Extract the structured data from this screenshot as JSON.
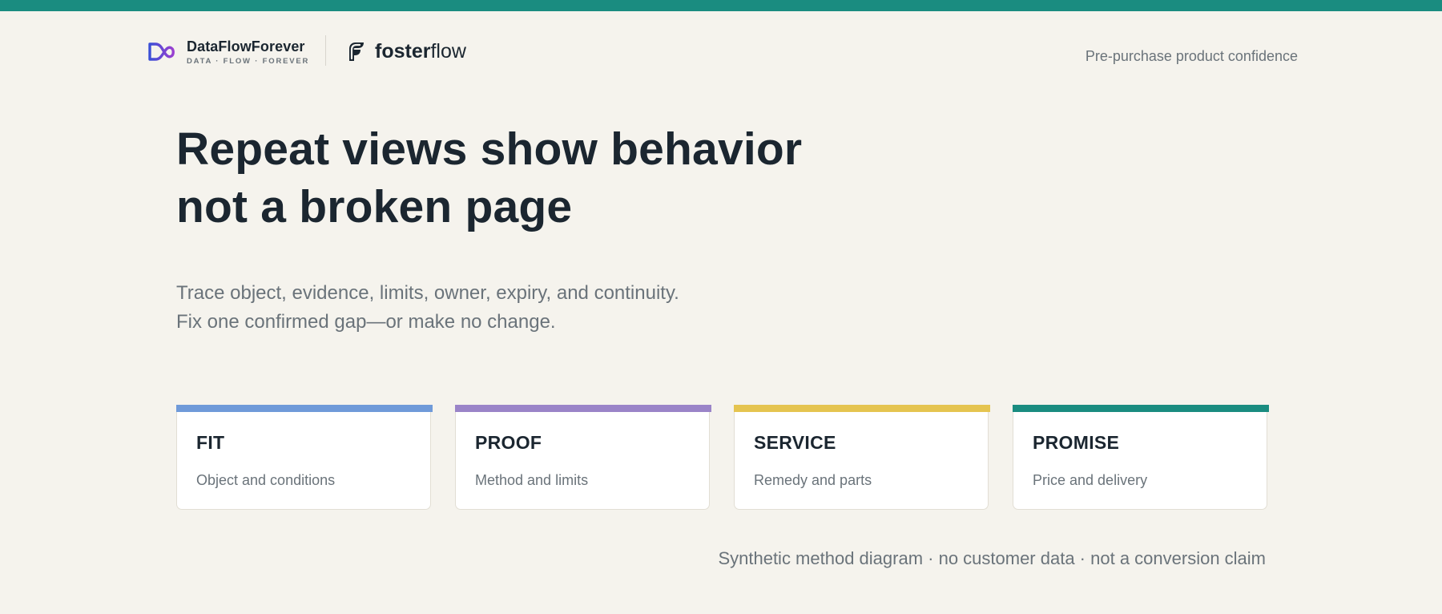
{
  "colors": {
    "top_strip": "#1a8c80",
    "background": "#f5f3ed",
    "text_dark": "#1b2630",
    "text_muted": "#6a737a"
  },
  "header": {
    "brand_name": "DataFlowForever",
    "brand_tagline": "DATA · FLOW · FOREVER",
    "brand_icon": "infinity-logo-icon",
    "partner_icon": "fosterflow-logo-icon",
    "partner_name_bold": "foster",
    "partner_name_light": "flow",
    "tagline": "Pre-purchase product confidence"
  },
  "hero": {
    "headline_line1": "Repeat views show behavior",
    "headline_line2": "not a broken page",
    "sub_line1": "Trace object, evidence, limits, owner, expiry, and continuity.",
    "sub_line2": "Fix one confirmed gap—or make no change."
  },
  "cards": [
    {
      "title": "FIT",
      "desc": "Object and conditions",
      "color": "#6f9ad9"
    },
    {
      "title": "PROOF",
      "desc": "Method and limits",
      "color": "#9a84c8"
    },
    {
      "title": "SERVICE",
      "desc": "Remedy and parts",
      "color": "#e5c450"
    },
    {
      "title": "PROMISE",
      "desc": "Price and delivery",
      "color": "#1a8c80"
    }
  ],
  "footnote": "Synthetic method diagram · no customer data · not a conversion claim"
}
